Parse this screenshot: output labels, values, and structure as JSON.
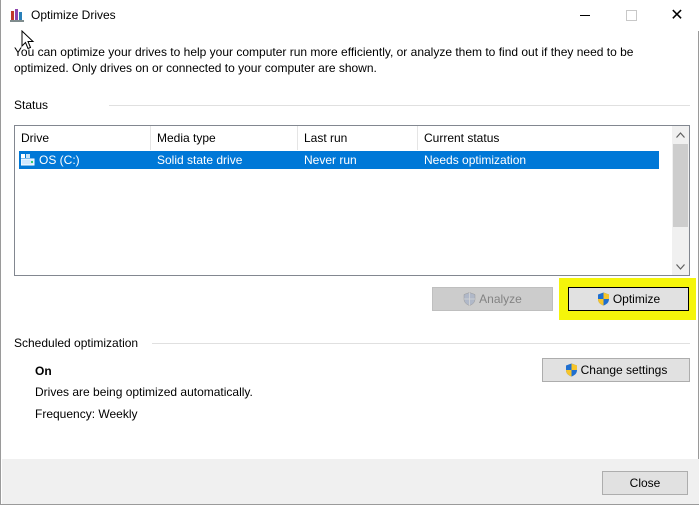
{
  "window": {
    "title": "Optimize Drives",
    "close_symbol": "✕"
  },
  "description": "You can optimize your drives to help your computer run more efficiently, or analyze them to find out if they need to be optimized. Only drives on or connected to your computer are shown.",
  "status": {
    "label": "Status",
    "columns": [
      "Drive",
      "Media type",
      "Last run",
      "Current status"
    ],
    "rows": [
      {
        "drive": "OS (C:)",
        "media_type": "Solid state drive",
        "last_run": "Never run",
        "current_status": "Needs optimization",
        "selected": true
      }
    ]
  },
  "buttons": {
    "analyze": "Analyze",
    "optimize": "Optimize",
    "change_settings": "Change settings",
    "close": "Close"
  },
  "scheduled": {
    "label": "Scheduled optimization",
    "state": "On",
    "description": "Drives are being optimized automatically.",
    "frequency": "Frequency: Weekly"
  },
  "colors": {
    "selection": "#0078d7",
    "highlight": "#f5f50a",
    "footer": "#f0f0f0"
  }
}
